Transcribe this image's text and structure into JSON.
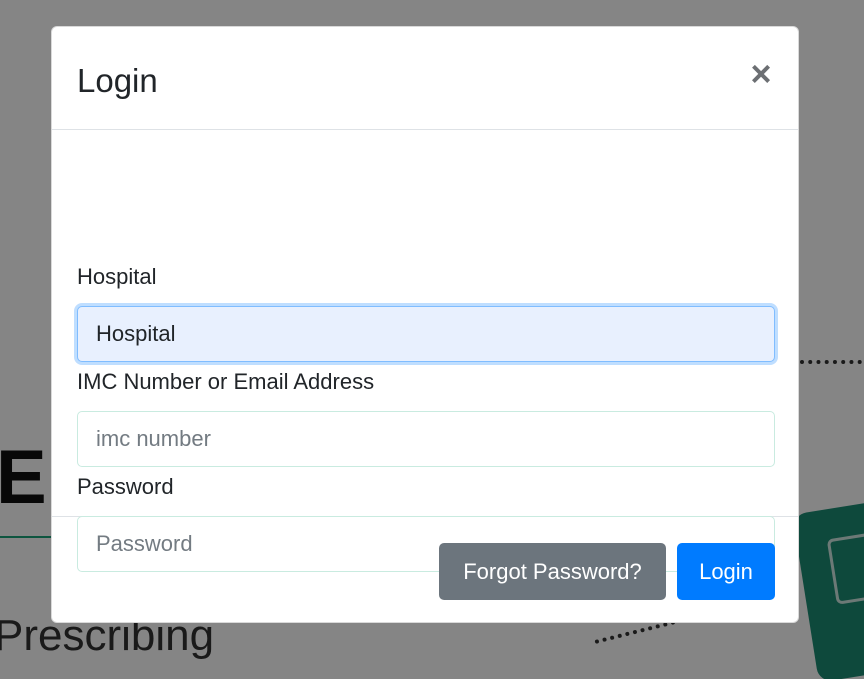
{
  "background": {
    "heading_fragment": "E",
    "subheading_fragment": "Prescribing"
  },
  "modal": {
    "title": "Login",
    "close_label": "×",
    "fields": {
      "hospital": {
        "label": "Hospital",
        "value": "Hospital",
        "placeholder": "Hospital"
      },
      "imc": {
        "label": "IMC Number or Email Address",
        "value": "",
        "placeholder": "imc number"
      },
      "password": {
        "label": "Password",
        "value": "",
        "placeholder": "Password"
      }
    },
    "buttons": {
      "forgot_label": "Forgot Password?",
      "login_label": "Login"
    }
  },
  "colors": {
    "primary": "#007bff",
    "secondary": "#6c757d",
    "focus_fill": "#e8f0fe",
    "accent_green": "#1aa37a"
  },
  "icons": {
    "close": "close-icon"
  }
}
